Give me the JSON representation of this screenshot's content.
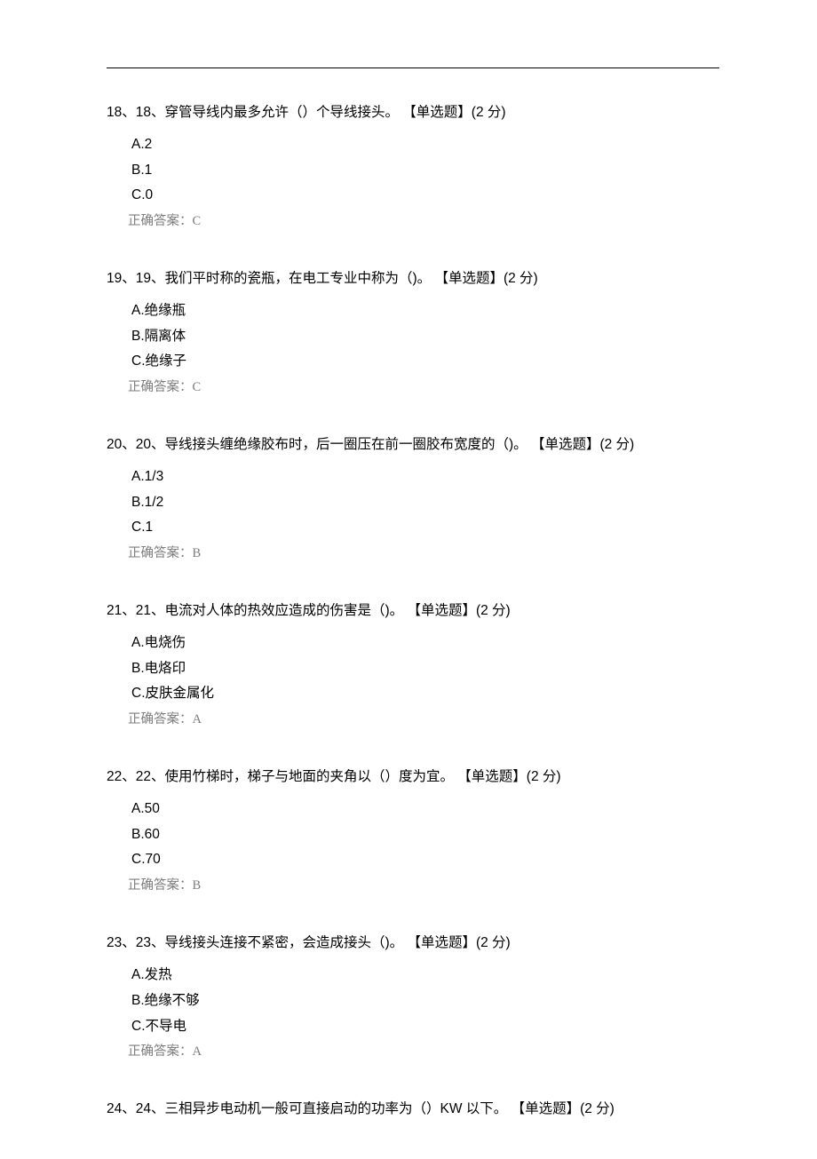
{
  "questions": [
    {
      "stem": "18、18、穿管导线内最多允许（）个导线接头。 【单选题】(2 分)",
      "options": [
        "A.2",
        "B.1",
        "C.0"
      ],
      "answer": "正确答案：C"
    },
    {
      "stem": "19、19、我们平时称的瓷瓶，在电工专业中称为（)。 【单选题】(2 分)",
      "options": [
        "A.绝缘瓶",
        "B.隔离体",
        "C.绝缘子"
      ],
      "answer": "正确答案：C"
    },
    {
      "stem": "20、20、导线接头缠绝缘胶布时，后一圈压在前一圈胶布宽度的（)。 【单选题】(2 分)",
      "options": [
        "A.1/3",
        "B.1/2",
        "C.1"
      ],
      "answer": "正确答案：B"
    },
    {
      "stem": "21、21、电流对人体的热效应造成的伤害是（)。 【单选题】(2 分)",
      "options": [
        "A.电烧伤",
        "B.电烙印",
        "C.皮肤金属化"
      ],
      "answer": "正确答案：A"
    },
    {
      "stem": "22、22、使用竹梯时，梯子与地面的夹角以（）度为宜。 【单选题】(2 分)",
      "options": [
        "A.50",
        "B.60",
        "C.70"
      ],
      "answer": "正确答案：B"
    },
    {
      "stem": "23、23、导线接头连接不紧密，会造成接头（)。 【单选题】(2 分)",
      "options": [
        "A.发热",
        "B.绝缘不够",
        "C.不导电"
      ],
      "answer": "正确答案：A"
    },
    {
      "stem": "24、24、三相异步电动机一般可直接启动的功率为（）KW 以下。 【单选题】(2 分)",
      "options": [],
      "answer": ""
    }
  ]
}
